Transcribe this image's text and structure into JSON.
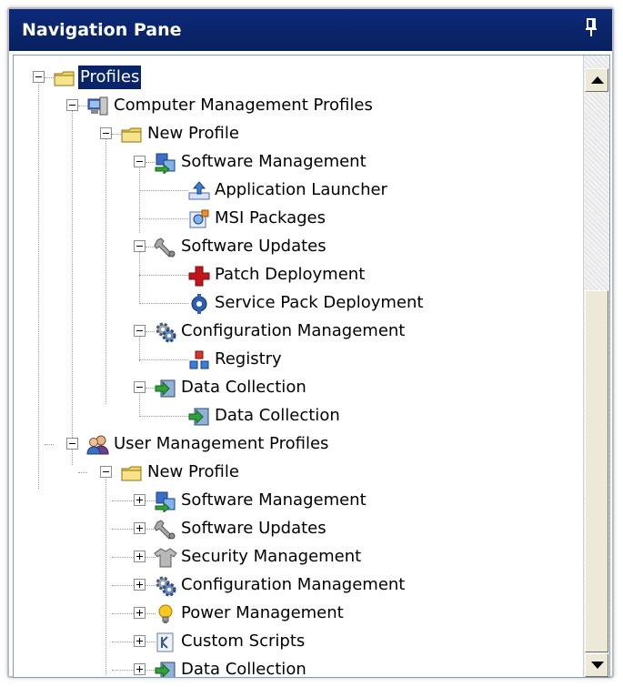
{
  "pane": {
    "title": "Navigation Pane"
  },
  "tree": {
    "root": "Profiles",
    "computer_profiles": {
      "label": "Computer Management Profiles",
      "new_profile": "New Profile",
      "software_management": {
        "label": "Software Management",
        "application_launcher": "Application Launcher",
        "msi_packages": "MSI Packages"
      },
      "software_updates": {
        "label": "Software Updates",
        "patch_deployment": "Patch Deployment",
        "service_pack_deployment": "Service Pack Deployment"
      },
      "configuration_management": {
        "label": "Configuration Management",
        "registry": "Registry"
      },
      "data_collection": {
        "label": "Data Collection",
        "child": "Data Collection"
      }
    },
    "user_profiles": {
      "label": "User Management Profiles",
      "new_profile": "New Profile",
      "software_management": "Software Management",
      "software_updates": "Software Updates",
      "security_management": "Security Management",
      "configuration_management": "Configuration Management",
      "power_management": "Power Management",
      "custom_scripts": "Custom Scripts",
      "data_collection": "Data Collection"
    }
  },
  "colors": {
    "title_bar": "#0a246a",
    "selection": "#0a246a"
  },
  "icons": {
    "folder": "folder-icon",
    "computer": "computer-icon",
    "users": "users-icon",
    "software": "software-management-icon",
    "app_launcher": "application-launcher-icon",
    "msi": "msi-package-icon",
    "wrench": "software-updates-icon",
    "patch": "patch-cross-icon",
    "service_pack": "service-pack-icon",
    "config": "configuration-gear-icon",
    "registry": "registry-icon",
    "data": "data-collection-icon",
    "security": "security-shirt-icon",
    "power": "power-bulb-icon",
    "script": "custom-script-icon"
  }
}
